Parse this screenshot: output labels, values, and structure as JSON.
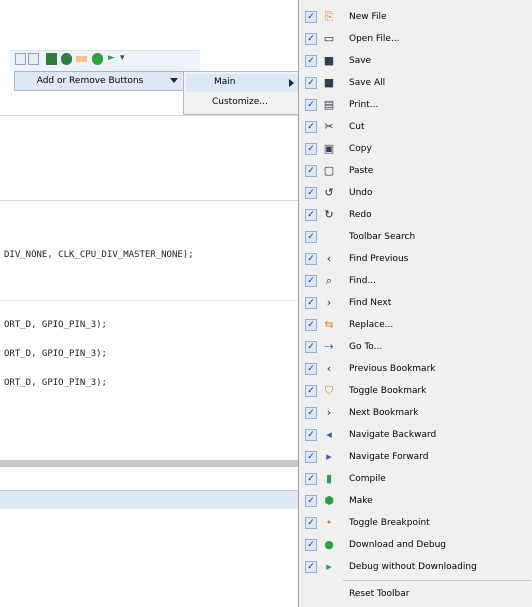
{
  "toolbar_dropdown": {
    "add_remove_label": "Add or Remove Buttons",
    "submenu": [
      {
        "label": "Main",
        "has_arrow": true
      },
      {
        "label": "Customize..."
      }
    ]
  },
  "editor": {
    "lines": [
      "DIV_NONE, CLK_CPU_DIV_MASTER_NONE);",
      "ORT_D, GPIO_PIN_3);",
      "ORT_D, GPIO_PIN_3);",
      "ORT_D, GPIO_PIN_3);"
    ]
  },
  "menu": {
    "items": [
      {
        "label": "New File",
        "checked": true,
        "icon": "new-file-icon"
      },
      {
        "label": "Open File...",
        "checked": true,
        "icon": "open-file-icon"
      },
      {
        "label": "Save",
        "checked": true,
        "icon": "save-icon"
      },
      {
        "label": "Save All",
        "checked": true,
        "icon": "save-all-icon"
      },
      {
        "label": "Print...",
        "checked": true,
        "icon": "print-icon"
      },
      {
        "label": "Cut",
        "checked": true,
        "icon": "cut-icon"
      },
      {
        "label": "Copy",
        "checked": true,
        "icon": "copy-icon"
      },
      {
        "label": "Paste",
        "checked": true,
        "icon": "paste-icon"
      },
      {
        "label": "Undo",
        "checked": true,
        "icon": "undo-icon"
      },
      {
        "label": "Redo",
        "checked": true,
        "icon": "redo-icon"
      },
      {
        "label": "Toolbar Search",
        "checked": true,
        "icon": ""
      },
      {
        "label": "Find Previous",
        "checked": true,
        "icon": "find-previous-icon"
      },
      {
        "label": "Find...",
        "checked": true,
        "icon": "find-icon"
      },
      {
        "label": "Find Next",
        "checked": true,
        "icon": "find-next-icon"
      },
      {
        "label": "Replace...",
        "checked": true,
        "icon": "replace-icon"
      },
      {
        "label": "Go To...",
        "checked": true,
        "icon": "goto-icon"
      },
      {
        "label": "Previous Bookmark",
        "checked": true,
        "icon": "previous-bookmark-icon"
      },
      {
        "label": "Toggle Bookmark",
        "checked": true,
        "icon": "toggle-bookmark-icon"
      },
      {
        "label": "Next Bookmark",
        "checked": true,
        "icon": "next-bookmark-icon"
      },
      {
        "label": "Navigate Backward",
        "checked": true,
        "icon": "navigate-backward-icon"
      },
      {
        "label": "Navigate Forward",
        "checked": true,
        "icon": "navigate-forward-icon"
      },
      {
        "label": "Compile",
        "checked": true,
        "icon": "compile-icon"
      },
      {
        "label": "Make",
        "checked": true,
        "icon": "make-icon"
      },
      {
        "label": "Toggle Breakpoint",
        "checked": true,
        "icon": "toggle-breakpoint-icon"
      },
      {
        "label": "Download and Debug",
        "checked": true,
        "icon": "download-debug-icon"
      },
      {
        "label": "Debug without Downloading",
        "checked": true,
        "icon": "debug-no-download-icon"
      }
    ],
    "reset_label": "Reset Toolbar"
  }
}
